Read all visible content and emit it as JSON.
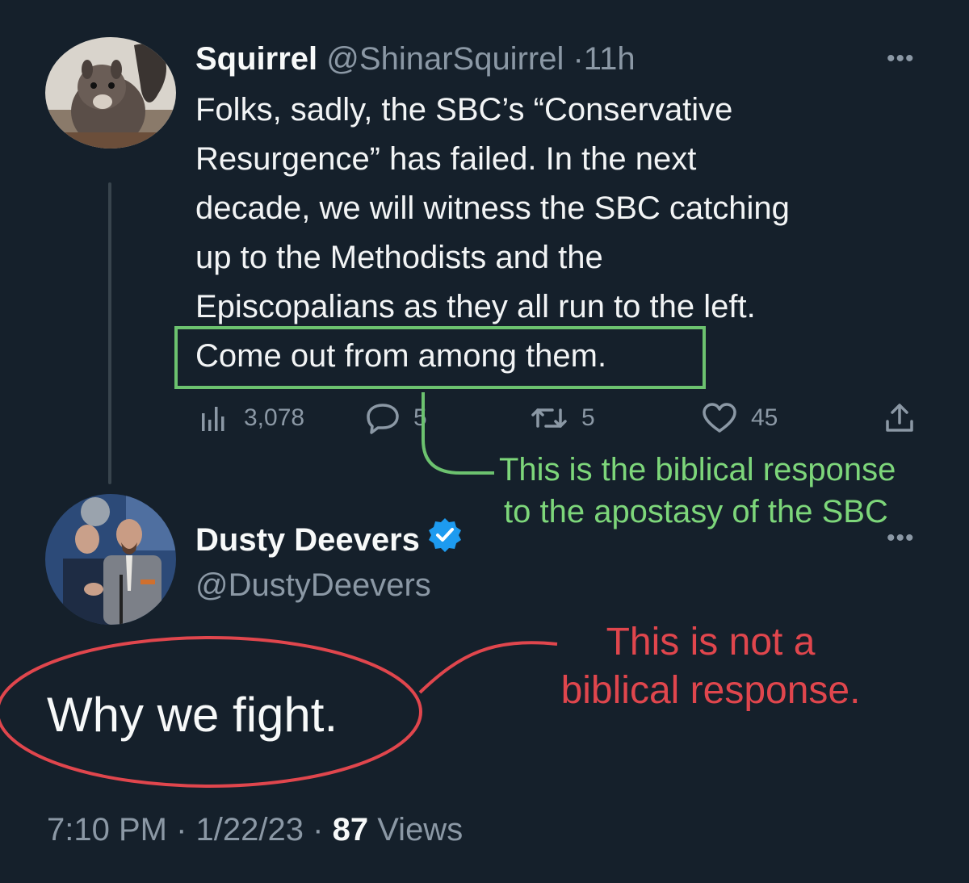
{
  "tweet1": {
    "display_name": "Squirrel",
    "handle": "@ShinarSquirrel",
    "separator": "·",
    "time": "11h",
    "more_label": "•••",
    "body_lines": [
      "Folks, sadly, the SBC’s “Conservative",
      "Resurgence” has failed. In the next",
      "decade, we will witness the SBC catching",
      "up to the Methodists and the",
      "Episcopalians as they all run to the left.",
      "Come out from among them."
    ],
    "stats": {
      "views": "3,078",
      "replies": "5",
      "retweets": "5",
      "likes": "45"
    },
    "icons": [
      "views-icon",
      "reply-icon",
      "retweet-icon",
      "like-icon",
      "share-icon"
    ]
  },
  "tweet2": {
    "display_name": "Dusty Deevers",
    "handle": "@DustyDeevers",
    "more_label": "•••",
    "verified_icon": "verified-badge-icon",
    "body": "Why we fight.",
    "time": "7:10 PM",
    "separator": "·",
    "date": "1/22/23",
    "views_count": "87",
    "views_label": "Views"
  },
  "annotations": {
    "green_lines": [
      "This is the biblical response",
      "to the apostasy of the SBC"
    ],
    "red_lines": [
      "This is not a",
      "biblical response."
    ]
  },
  "colors": {
    "background": "#15202b",
    "text": "#e7e9ea",
    "muted": "#8b98a5",
    "annotation_green": "#6cc26f",
    "annotation_red": "#e0464d",
    "verified_blue": "#1d9bf0"
  }
}
